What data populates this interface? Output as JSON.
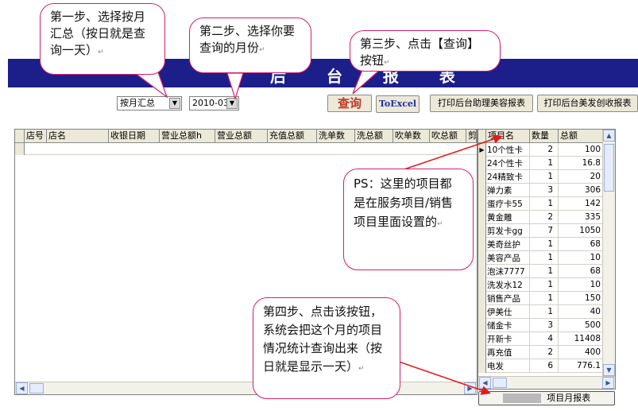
{
  "callouts": {
    "step1": "第一步、选择按月汇总（按日就是查询一天）",
    "step2": "第二步、选择你要查询的月份",
    "step3": "第三步、点击【查询】按钮",
    "ps": "PS：这里的项目都是在服务项目/销售项目里面设置的",
    "step4": "第四步、点击该按钮，系统会把这个月的项目情况统计查询出来（按日就是显示一天）",
    "para_mark": "↵"
  },
  "banner": {
    "title": "后 台 报 表"
  },
  "toolbar": {
    "mode_select": "按月汇总",
    "month_select": "2010-03",
    "query_label": "查询",
    "excel_label": "ToExcel",
    "print_assistant_label": "打印后台助理美容报表",
    "print_hair_label": "打印后台美发创收报表"
  },
  "main_grid": {
    "columns": [
      "店号",
      "店名",
      "收银日期",
      "营业总额h",
      "营业总额",
      "充值总额",
      "洗单数",
      "洗总额",
      "吹单数",
      "吹总额",
      "剪"
    ]
  },
  "item_grid": {
    "columns": [
      "项目名",
      "数量",
      "总额"
    ],
    "rows": [
      {
        "name": "10个性卡",
        "qty": "2",
        "total": "100"
      },
      {
        "name": "24个性卡",
        "qty": "1",
        "total": "16.8"
      },
      {
        "name": "24精致卡",
        "qty": "1",
        "total": "20"
      },
      {
        "name": "弹力素",
        "qty": "3",
        "total": "306"
      },
      {
        "name": "蛋疗卡55",
        "qty": "1",
        "total": "142"
      },
      {
        "name": "黄金雕",
        "qty": "2",
        "total": "335"
      },
      {
        "name": "剪发卡gg",
        "qty": "7",
        "total": "1050"
      },
      {
        "name": "美奇丝护",
        "qty": "1",
        "total": "68"
      },
      {
        "name": "美容产品",
        "qty": "1",
        "total": "10"
      },
      {
        "name": "泡沫7777",
        "qty": "1",
        "total": "68"
      },
      {
        "name": "洗发水12",
        "qty": "1",
        "total": "10"
      },
      {
        "name": "销售产品",
        "qty": "1",
        "total": "150"
      },
      {
        "name": "伊美仕",
        "qty": "1",
        "total": "40"
      },
      {
        "name": "储金卡",
        "qty": "3",
        "total": "500"
      },
      {
        "name": "开新卡",
        "qty": "4",
        "total": "11408"
      },
      {
        "name": "再充值",
        "qty": "2",
        "total": "400"
      },
      {
        "name": "电发",
        "qty": "6",
        "total": "776.1"
      }
    ]
  },
  "bottom": {
    "report_button": "项目月报表"
  },
  "colors": {
    "banner": "#1c1f8a",
    "callout_border": "#d21f6f",
    "arrow": "#e11a1a"
  }
}
